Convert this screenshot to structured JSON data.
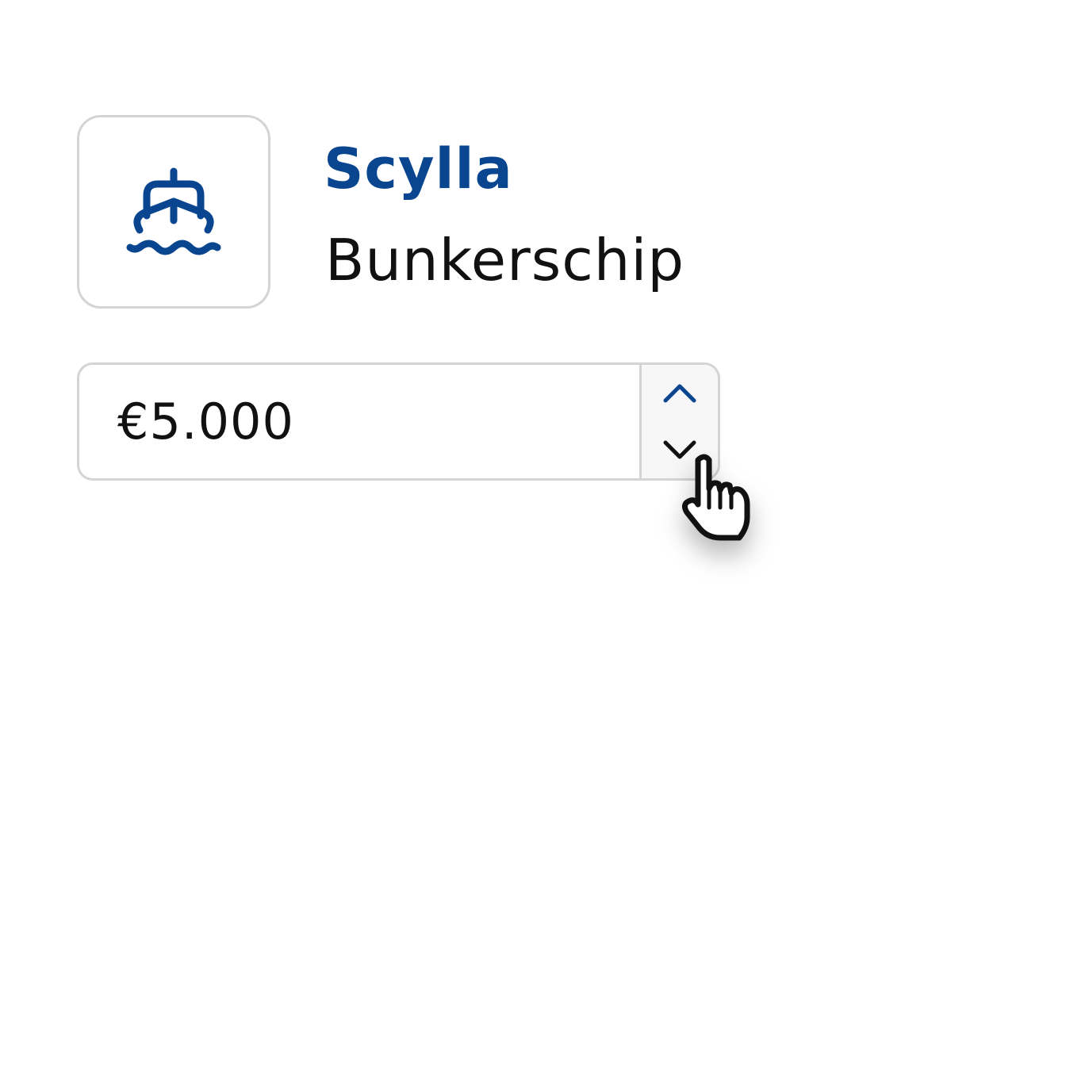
{
  "vessel": {
    "name": "Scylla",
    "type": "Bunkerschip",
    "icon": "ship-icon"
  },
  "stepper": {
    "value": "€5.000",
    "increment_icon": "chevron-up-icon",
    "decrement_icon": "chevron-down-icon"
  },
  "cursor": {
    "icon": "hand-pointer-icon"
  },
  "colors": {
    "brand": "#0a4590",
    "text": "#111111",
    "border": "#d4d4d4"
  }
}
